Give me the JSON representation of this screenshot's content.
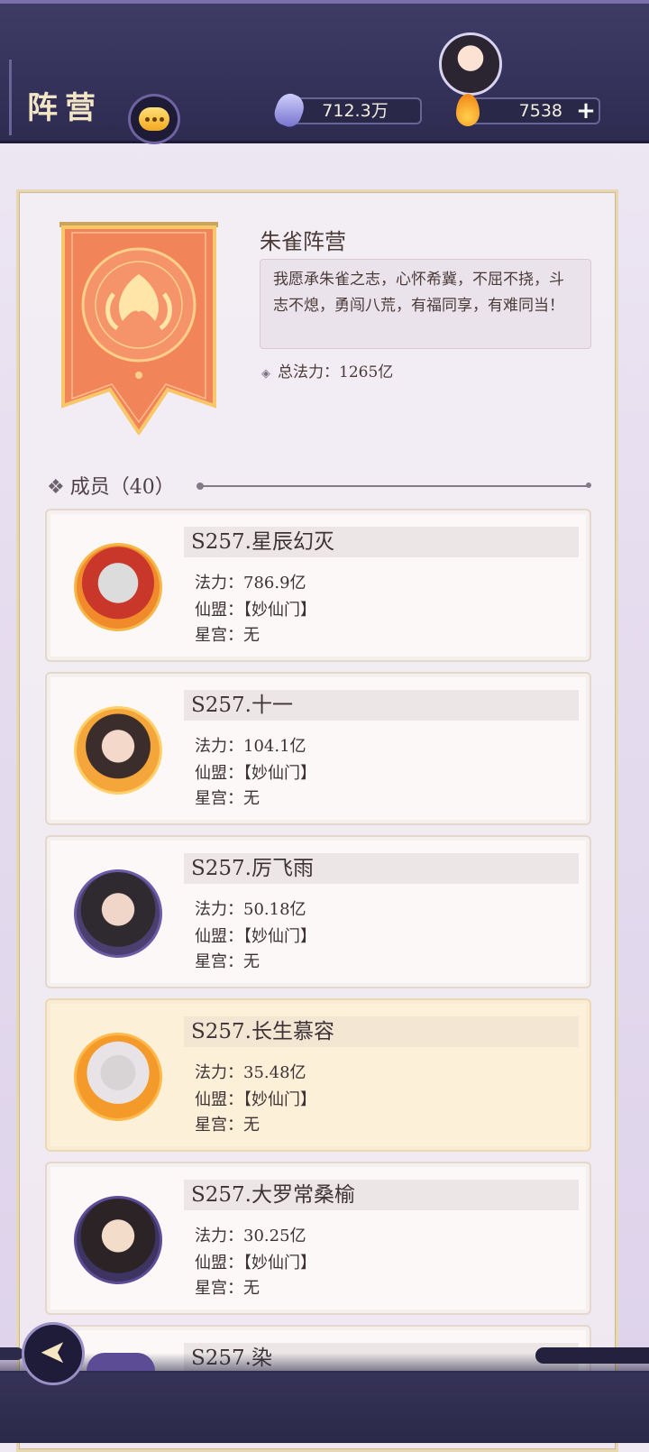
{
  "header": {
    "title": "阵营",
    "currency1": "712.3万",
    "currency2": "7538",
    "plus_label": "+"
  },
  "faction": {
    "name": "朱雀阵营",
    "motto": "我愿承朱雀之志，心怀希冀，不屈不挠，斗志不熄，勇闯八荒，有福同享，有难同当！",
    "total_power_label": "总法力：",
    "total_power_value": "1265亿"
  },
  "members": {
    "heading": "成员（40）",
    "label_power": "法力：",
    "label_alliance": "仙盟：",
    "label_palace": "星宫：",
    "list": [
      {
        "name": "S257.星辰幻灭",
        "power": "786.9亿",
        "alliance": "【妙仙门】",
        "palace": "无"
      },
      {
        "name": "S257.十一",
        "power": "104.1亿",
        "alliance": "【妙仙门】",
        "palace": "无"
      },
      {
        "name": "S257.厉飞雨",
        "power": "50.18亿",
        "alliance": "【妙仙门】",
        "palace": "无"
      },
      {
        "name": "S257.长生慕容",
        "power": "35.48亿",
        "alliance": "【妙仙门】",
        "palace": "无"
      },
      {
        "name": "S257.大罗常桑榆",
        "power": "30.25亿",
        "alliance": "【妙仙门】",
        "palace": "无"
      },
      {
        "name": "S257.染"
      }
    ]
  },
  "colors": {
    "topbar": "#34325a",
    "panel": "#f3eef4",
    "highlight_card": "#fdf0d8",
    "banner": "#f07c4a"
  }
}
